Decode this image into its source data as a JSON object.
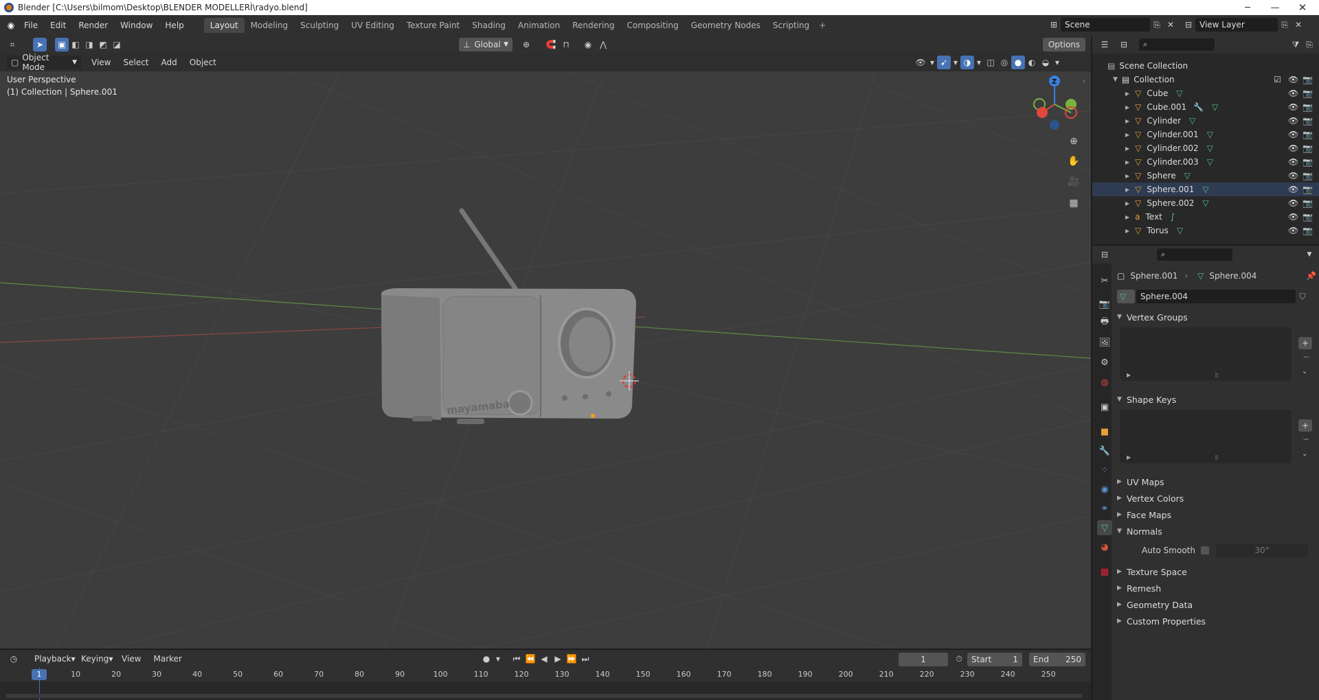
{
  "window": {
    "title": "Blender [C:\\Users\\bilmom\\Desktop\\BLENDER MODELLERİ\\radyo.blend]"
  },
  "menus": [
    "File",
    "Edit",
    "Render",
    "Window",
    "Help"
  ],
  "workspaces": [
    "Layout",
    "Modeling",
    "Sculpting",
    "UV Editing",
    "Texture Paint",
    "Shading",
    "Animation",
    "Rendering",
    "Compositing",
    "Geometry Nodes",
    "Scripting"
  ],
  "scene": {
    "name": "Scene",
    "view_layer": "View Layer"
  },
  "viewport": {
    "orientation": "Global",
    "options_label": "Options",
    "mode": "Object Mode",
    "menu": [
      "View",
      "Select",
      "Add",
      "Object"
    ],
    "overlay_title": "User Perspective",
    "overlay_sub": "(1) Collection | Sphere.001",
    "axis_labels": {
      "z": "Z",
      "x": "X",
      "y": "Y"
    },
    "radio_brand": "mayamaba"
  },
  "outliner": {
    "root": "Scene Collection",
    "collection": "Collection",
    "items": [
      {
        "name": "Cube",
        "type": "mesh"
      },
      {
        "name": "Cube.001",
        "type": "mesh",
        "modifier": true
      },
      {
        "name": "Cylinder",
        "type": "mesh"
      },
      {
        "name": "Cylinder.001",
        "type": "mesh"
      },
      {
        "name": "Cylinder.002",
        "type": "mesh"
      },
      {
        "name": "Cylinder.003",
        "type": "mesh"
      },
      {
        "name": "Sphere",
        "type": "mesh"
      },
      {
        "name": "Sphere.001",
        "type": "mesh",
        "selected": true
      },
      {
        "name": "Sphere.002",
        "type": "mesh"
      },
      {
        "name": "Text",
        "type": "text"
      },
      {
        "name": "Torus",
        "type": "mesh"
      }
    ]
  },
  "properties": {
    "object": "Sphere.001",
    "mesh": "Sphere.004",
    "datablock": "Sphere.004",
    "panels": {
      "vertex_groups": "Vertex Groups",
      "shape_keys": "Shape Keys",
      "uv_maps": "UV Maps",
      "vertex_colors": "Vertex Colors",
      "face_maps": "Face Maps",
      "normals": "Normals",
      "auto_smooth": "Auto Smooth",
      "auto_smooth_angle": "30°",
      "texture_space": "Texture Space",
      "remesh": "Remesh",
      "geometry_data": "Geometry Data",
      "custom_properties": "Custom Properties"
    }
  },
  "timeline": {
    "menu": [
      "Playback",
      "Keying",
      "View",
      "Marker"
    ],
    "current_frame": "1",
    "start_label": "Start",
    "start": "1",
    "end_label": "End",
    "end": "250",
    "ticks": [
      "1",
      "10",
      "20",
      "30",
      "40",
      "50",
      "60",
      "70",
      "80",
      "90",
      "100",
      "110",
      "120",
      "130",
      "140",
      "150",
      "160",
      "170",
      "180",
      "190",
      "200",
      "210",
      "220",
      "230",
      "240",
      "250"
    ]
  },
  "colors": {
    "accent": "#4772b3",
    "mesh_icon": "#e7a03b",
    "data_icon": "#55c08a",
    "x_axis": "#e0483d",
    "y_axis": "#78b33c",
    "z_axis": "#3b80dd"
  }
}
